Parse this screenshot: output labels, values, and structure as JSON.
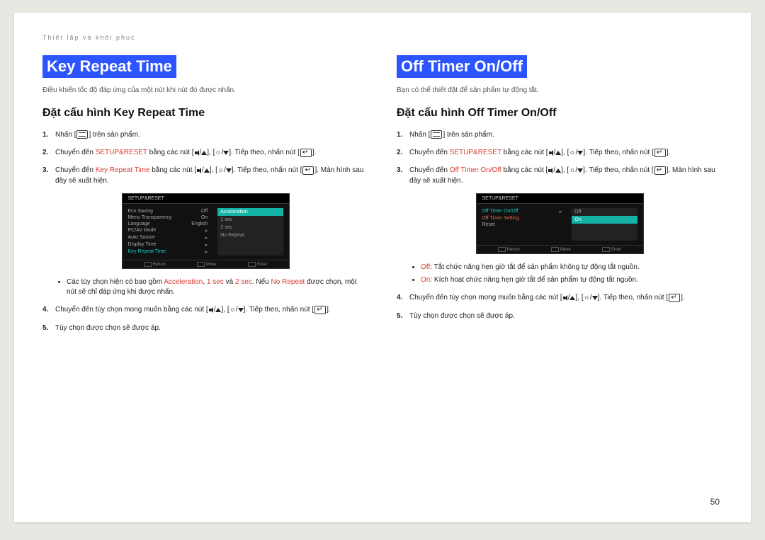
{
  "breadcrumb": "Thiết lập và khôi phục",
  "page_number": "50",
  "left": {
    "title": "Key Repeat Time",
    "intro": "Điều khiển tốc độ đáp ứng của một nút khi nút đó được nhấn.",
    "subtitle": "Đặt cấu hình Key Repeat Time",
    "steps": {
      "s1_a": "Nhấn [",
      "s1_b": "] trên sản phẩm.",
      "s2_a": "Chuyển đến ",
      "s2_hl": "SETUP&RESET",
      "s2_b": " bằng các nút [",
      "s2_c": "], [",
      "s2_d": "]. Tiếp theo, nhấn nút [",
      "s2_e": "].",
      "s3_a": "Chuyển đến ",
      "s3_hl": "Key Repeat Time",
      "s3_b": " bằng các nút [",
      "s3_c": "], [",
      "s3_d": "]. Tiếp theo, nhấn nút [",
      "s3_e": "]. Màn hình sau đây sẽ xuất hiện.",
      "s4_a": "Chuyển đến tùy chọn mong muốn bằng các nút [",
      "s4_b": "], [",
      "s4_c": "]. Tiếp theo, nhấn nút [",
      "s4_d": "].",
      "s5": "Tùy chọn được chọn sẽ được áp."
    },
    "note_a": "Các tùy chọn hiện có bao gồm ",
    "note_hl1": "Acceleration",
    "note_sep1": ", ",
    "note_hl2": "1 sec",
    "note_sep2": " và ",
    "note_hl3": "2 sec",
    "note_b": ". Nếu ",
    "note_hl4": "No Repeat",
    "note_c": " được chọn, một nút sẽ chỉ đáp ứng khi được nhấn.",
    "osd": {
      "header": "SETUP&RESET",
      "items": [
        {
          "label": "Eco Saving",
          "val": "Off"
        },
        {
          "label": "Menu Transparency",
          "val": "On"
        },
        {
          "label": "Language",
          "val": "English"
        },
        {
          "label": "PC/AV Mode",
          "val": ""
        },
        {
          "label": "Auto Source",
          "val": ""
        },
        {
          "label": "Display Time",
          "val": ""
        },
        {
          "label": "Key Repeat Time",
          "val": ""
        }
      ],
      "opts": [
        "Acceleration",
        "1 sec",
        "2 sec",
        "No Repeat"
      ],
      "foot1": "Return",
      "foot2": "Move",
      "foot3": "Enter"
    }
  },
  "right": {
    "title": "Off Timer On/Off",
    "intro": "Bạn có thể thiết đặt để sản phẩm tự động tắt.",
    "subtitle": "Đặt cấu hình Off Timer On/Off",
    "steps": {
      "s1_a": "Nhấn [",
      "s1_b": "] trên sản phẩm.",
      "s2_a": "Chuyển đến ",
      "s2_hl": "SETUP&RESET",
      "s2_b": " bằng các nút [",
      "s2_c": "], [",
      "s2_d": "]. Tiếp theo, nhấn nút [",
      "s2_e": "].",
      "s3_a": "Chuyển đến ",
      "s3_hl": "Off Timer On/Off",
      "s3_b": " bằng các nút [",
      "s3_c": "], [",
      "s3_d": "]. Tiếp theo, nhấn nút [",
      "s3_e": "]. Màn hình sau đây sẽ xuất hiện.",
      "s4_a": "Chuyển đến tùy chọn mong muốn bằng các nút [",
      "s4_b": "], [",
      "s4_c": "]. Tiếp theo, nhấn nút [",
      "s4_d": "].",
      "s5": "Tùy chọn được chọn sẽ được áp."
    },
    "bul1_hl": "Off",
    "bul1": ": Tắt chức năng hẹn giờ tắt để sản phẩm không tự động tắt nguồn.",
    "bul2_hl": "On",
    "bul2": ": Kích hoạt chức năng hẹn giờ tắt để sản phẩm tự động tắt nguồn.",
    "osd": {
      "header": "SETUP&RESET",
      "items": [
        {
          "label": "Off Timer On/Off",
          "val": ""
        },
        {
          "label": "Off Timer Setting",
          "val": ""
        },
        {
          "label": "Reset",
          "val": ""
        }
      ],
      "opts": [
        "Off",
        "On"
      ],
      "foot1": "Return",
      "foot2": "Move",
      "foot3": "Enter"
    }
  }
}
